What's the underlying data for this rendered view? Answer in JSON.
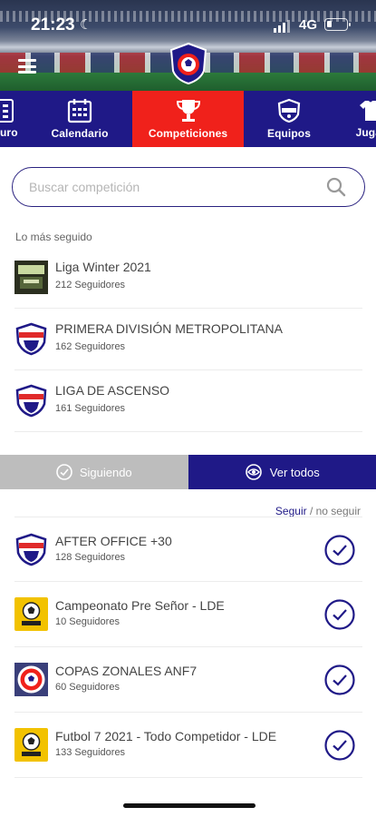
{
  "status_bar": {
    "time": "21:23",
    "network": "4G"
  },
  "tabs": [
    {
      "label": "uro",
      "icon": "calculator-icon",
      "active": false
    },
    {
      "label": "Calendario",
      "icon": "calendar-icon",
      "active": false
    },
    {
      "label": "Competiciones",
      "icon": "trophy-icon",
      "active": true
    },
    {
      "label": "Equipos",
      "icon": "team-badge-icon",
      "active": false
    },
    {
      "label": "Juga",
      "icon": "jersey-icon",
      "active": false
    }
  ],
  "search": {
    "placeholder": "Buscar competición"
  },
  "most_followed": {
    "title": "Lo más seguido",
    "items": [
      {
        "name": "Liga Winter 2021",
        "followers": "212 Seguidores",
        "thumb": "liga-winter-thumb"
      },
      {
        "name": "PRIMERA DIVISIÓN METROPOLITANA",
        "followers": "162 Seguidores",
        "thumb": "shield-logo"
      },
      {
        "name": "LIGA DE ASCENSO",
        "followers": "161 Seguidores",
        "thumb": "shield-logo"
      }
    ]
  },
  "toggle": {
    "following_label": "Siguiendo",
    "view_all_label": "Ver todos"
  },
  "follow_hint": {
    "follow": "Seguir",
    "separator": " / ",
    "unfollow": "no seguir"
  },
  "competitions": [
    {
      "name": "AFTER OFFICE +30",
      "followers": "128 Seguidores",
      "thumb": "shield-logo",
      "following": true
    },
    {
      "name": "Campeonato Pre Señor - LDE",
      "followers": "10 Seguidores",
      "thumb": "ball-logo",
      "following": true
    },
    {
      "name": "COPAS ZONALES ANF7",
      "followers": "60 Seguidores",
      "thumb": "federation-logo",
      "following": true
    },
    {
      "name": "Futbol 7 2021 - Todo Competidor -  LDE",
      "followers": "133 Seguidores",
      "thumb": "ball-logo",
      "following": true
    }
  ],
  "colors": {
    "primary": "#1f1987",
    "active_tab": "#f0211b",
    "toggle_inactive": "#bdbdbd"
  }
}
